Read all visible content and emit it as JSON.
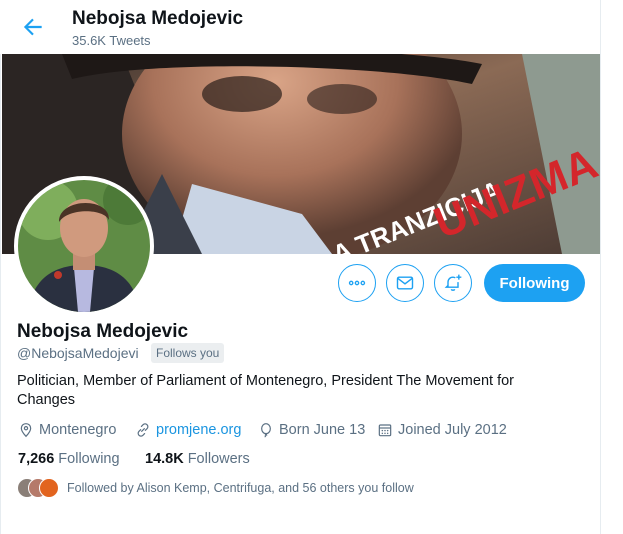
{
  "header": {
    "title": "Nebojsa Medojevic",
    "tweet_count": "35.6K Tweets"
  },
  "banner": {
    "text_a": "A TRANZICIJA",
    "text_b": "UNIZMA"
  },
  "actions": {
    "follow_label": "Following"
  },
  "profile": {
    "name": "Nebojsa Medojevic",
    "handle": "@NebojsaMedojevi",
    "follows_you": "Follows you",
    "bio": "Politician, Member of Parliament of Montenegro, President The Movement for Changes",
    "location": "Montenegro",
    "website": "promjene.org",
    "born": "Born June 13",
    "joined": "Joined July 2012",
    "following_count": "7,266",
    "following_label": "Following",
    "followers_count": "14.8K",
    "followers_label": "Followers",
    "followed_by": "Followed by Alison Kemp, Centrifuga, and 56 others you follow"
  },
  "colors": {
    "accent": "#1da1f2",
    "secondary_text": "#5b7083"
  },
  "icons": [
    "back-arrow-icon",
    "more-icon",
    "mail-icon",
    "bell-plus-icon",
    "location-icon",
    "link-icon",
    "balloon-icon",
    "calendar-icon"
  ]
}
